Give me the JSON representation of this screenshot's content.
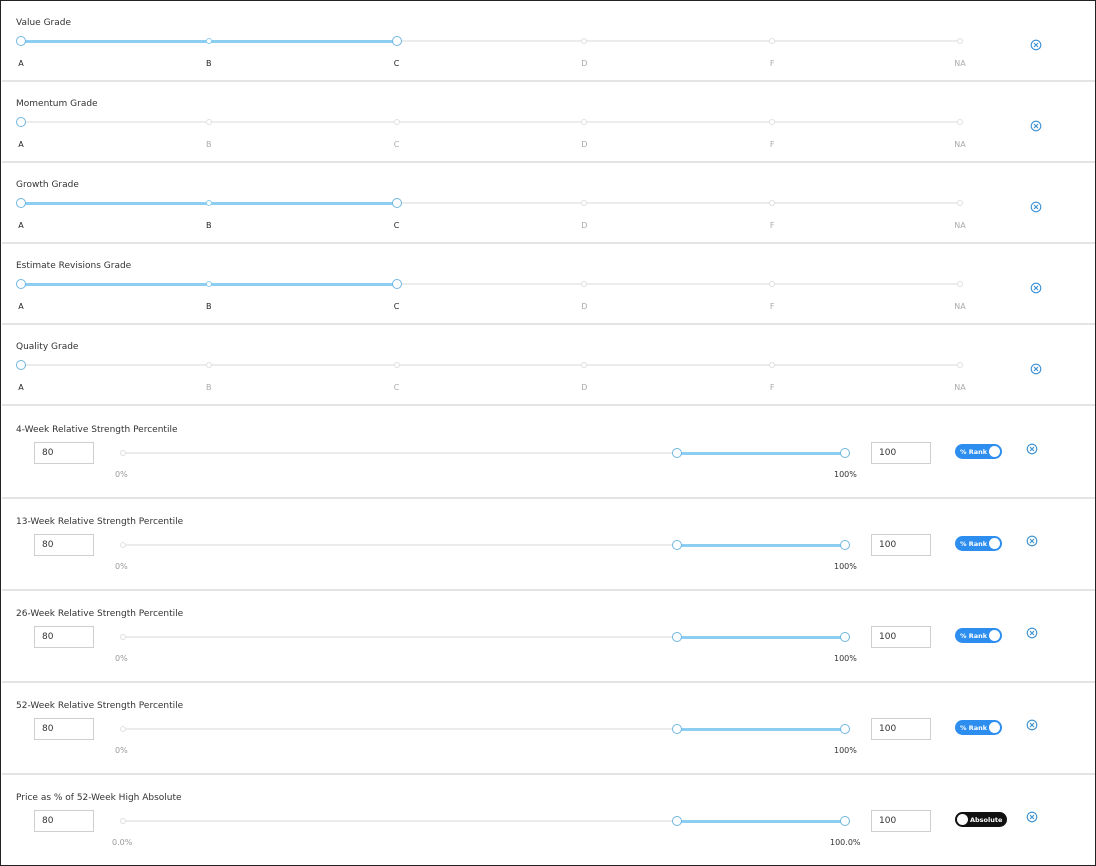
{
  "colors": {
    "accent": "#8ccdf2",
    "toggle_on": "#2e8ef0",
    "toggle_off": "#111111",
    "close": "#3a8fd0"
  },
  "grade_labels": [
    "A",
    "B",
    "C",
    "D",
    "F",
    "NA"
  ],
  "grade_filters": [
    {
      "label": "Value Grade",
      "selected_range": [
        "A",
        "C"
      ]
    },
    {
      "label": "Momentum Grade",
      "selected_range": [
        "A",
        "A"
      ]
    },
    {
      "label": "Growth Grade",
      "selected_range": [
        "A",
        "C"
      ]
    },
    {
      "label": "Estimate Revisions Grade",
      "selected_range": [
        "A",
        "C"
      ]
    },
    {
      "label": "Quality Grade",
      "selected_range": [
        "A",
        "A"
      ]
    }
  ],
  "range_filters": [
    {
      "label": "4-Week Relative Strength Percentile",
      "min_value": "80",
      "max_value": "100",
      "min_label": "0%",
      "max_label": "100%",
      "range_fraction": [
        0.8,
        1.0
      ],
      "toggle_label": "% Rank",
      "toggle_on": true
    },
    {
      "label": "13-Week Relative Strength Percentile",
      "min_value": "80",
      "max_value": "100",
      "min_label": "0%",
      "max_label": "100%",
      "range_fraction": [
        0.8,
        1.0
      ],
      "toggle_label": "% Rank",
      "toggle_on": true
    },
    {
      "label": "26-Week Relative Strength Percentile",
      "min_value": "80",
      "max_value": "100",
      "min_label": "0%",
      "max_label": "100%",
      "range_fraction": [
        0.8,
        1.0
      ],
      "toggle_label": "% Rank",
      "toggle_on": true
    },
    {
      "label": "52-Week Relative Strength Percentile",
      "min_value": "80",
      "max_value": "100",
      "min_label": "0%",
      "max_label": "100%",
      "range_fraction": [
        0.8,
        1.0
      ],
      "toggle_label": "% Rank",
      "toggle_on": true
    },
    {
      "label": "Price as % of 52-Week High Absolute",
      "min_value": "80",
      "max_value": "100",
      "min_label": "0.0%",
      "max_label": "100.0%",
      "range_fraction": [
        0.8,
        1.0
      ],
      "toggle_label": "Absolute",
      "toggle_on": false
    }
  ],
  "icons": {
    "remove": "close-circle-icon"
  }
}
